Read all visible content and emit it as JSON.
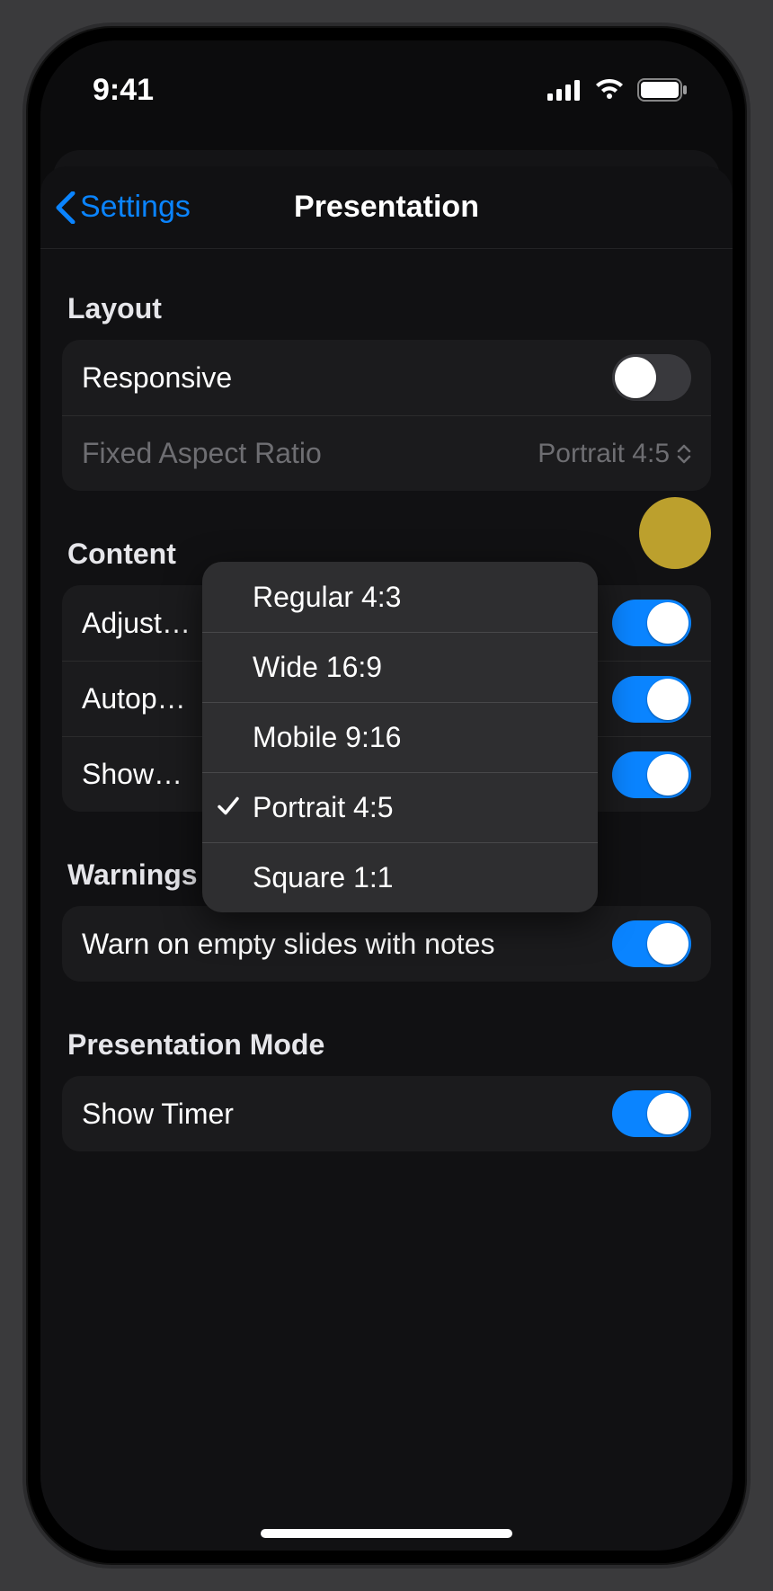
{
  "status_bar": {
    "time": "9:41"
  },
  "nav": {
    "back": "Settings",
    "title": "Presentation"
  },
  "sections": {
    "layout": {
      "header": "Layout",
      "responsive": {
        "label": "Responsive",
        "on": false
      },
      "fixed_aspect": {
        "label": "Fixed Aspect Ratio",
        "value": "Portrait 4:5"
      }
    },
    "content": {
      "header": "Content",
      "adjust": {
        "label": "Adjust…",
        "on": true
      },
      "autoplay": {
        "label": "Autop…",
        "on": true
      },
      "show": {
        "label": "Show…",
        "on": true
      }
    },
    "warnings": {
      "header": "Warnings",
      "warn_empty": {
        "label": "Warn on empty slides with notes",
        "on": true
      }
    },
    "presentation_mode": {
      "header": "Presentation Mode",
      "show_timer": {
        "label": "Show Timer",
        "on": true
      }
    }
  },
  "popover": {
    "options": [
      {
        "label": "Regular 4:3",
        "selected": false
      },
      {
        "label": "Wide 16:9",
        "selected": false
      },
      {
        "label": "Mobile 9:16",
        "selected": false
      },
      {
        "label": "Portrait 4:5",
        "selected": true
      },
      {
        "label": "Square 1:1",
        "selected": false
      }
    ]
  }
}
